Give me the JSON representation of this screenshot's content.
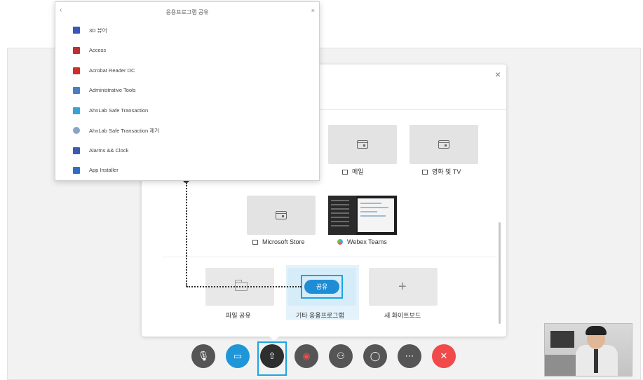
{
  "popup": {
    "title": "응용프로그램 공유",
    "back_icon": "‹",
    "close_icon": "×",
    "apps": [
      {
        "label": "3D 뷰어",
        "icon": "3d-viewer-icon",
        "color": "#3a56b8"
      },
      {
        "label": "Access",
        "icon": "access-icon",
        "color": "#b83232"
      },
      {
        "label": "Acrobat Reader DC",
        "icon": "acrobat-icon",
        "color": "#d02d2d"
      },
      {
        "label": "Administrative Tools",
        "icon": "admin-tools-icon",
        "color": "#4a7ec4"
      },
      {
        "label": "AhnLab Safe Transaction",
        "icon": "ahnlab-icon",
        "color": "#3aa0d8"
      },
      {
        "label": "AhnLab Safe Transaction 제거",
        "icon": "ahnlab-remove-icon",
        "color": "#8aa4c4"
      },
      {
        "label": "Alarms && Clock",
        "icon": "alarm-clock-icon",
        "color": "#3d5ab0"
      },
      {
        "label": "App Installer",
        "icon": "app-installer-icon",
        "color": "#2f6fc0"
      }
    ]
  },
  "share_panel": {
    "close_icon": "×",
    "apps": [
      {
        "label": "메일"
      },
      {
        "label": "영화 및 TV"
      },
      {
        "label": "Microsoft Store"
      },
      {
        "label": "Webex Teams"
      }
    ],
    "options": {
      "file_share": "파일 공유",
      "other_app": "기타 응용프로그램",
      "share_button": "공유",
      "whiteboard": "새 화이트보드"
    }
  },
  "controls": [
    {
      "name": "mute-button",
      "icon": "mic-off-icon",
      "glyph": "🎙"
    },
    {
      "name": "video-button",
      "icon": "video-icon",
      "glyph": "▭"
    },
    {
      "name": "share-button",
      "icon": "share-upload-icon",
      "glyph": "⇧"
    },
    {
      "name": "record-button",
      "icon": "record-icon",
      "glyph": "◉"
    },
    {
      "name": "participants-button",
      "icon": "participants-icon",
      "glyph": "⚇"
    },
    {
      "name": "chat-button",
      "icon": "chat-icon",
      "glyph": "◯"
    },
    {
      "name": "more-button",
      "icon": "more-icon",
      "glyph": "⋯"
    },
    {
      "name": "leave-button",
      "icon": "close-icon",
      "glyph": "✕"
    }
  ],
  "colors": {
    "accent": "#1f8dd6",
    "highlight": "#1aa6e0",
    "leave": "#f04a4a"
  }
}
